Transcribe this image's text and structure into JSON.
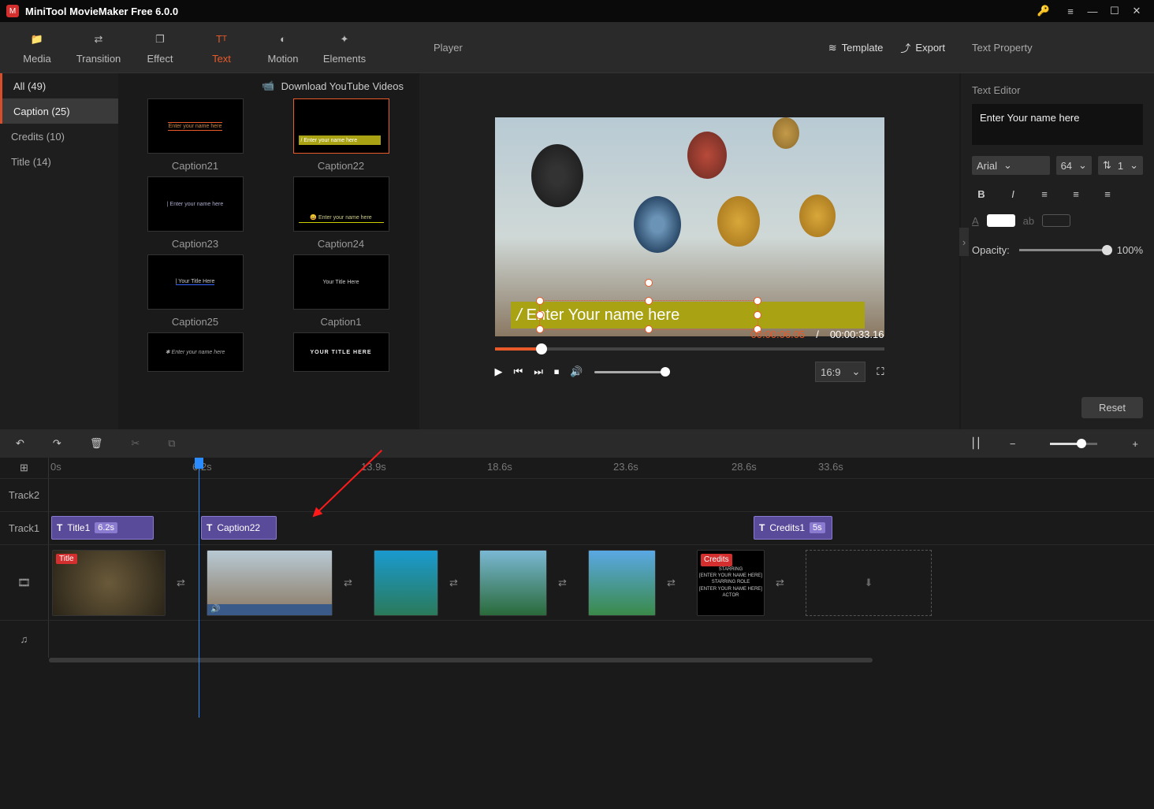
{
  "app": {
    "title": "MiniTool MovieMaker Free 6.0.0"
  },
  "toolbar": {
    "media": "Media",
    "transition": "Transition",
    "effect": "Effect",
    "text": "Text",
    "motion": "Motion",
    "elements": "Elements"
  },
  "browser": {
    "download": "Download YouTube Videos",
    "categories": {
      "all": "All (49)",
      "caption": "Caption (25)",
      "credits": "Credits (10)",
      "title": "Title (14)"
    },
    "items": [
      {
        "label": "Caption21"
      },
      {
        "label": "Caption22"
      },
      {
        "label": "Caption23"
      },
      {
        "label": "Caption24"
      },
      {
        "label": "Caption25"
      },
      {
        "label": "Caption1"
      },
      {
        "label": ""
      },
      {
        "label": ""
      }
    ]
  },
  "player": {
    "title": "Player",
    "template": "Template",
    "export": "Export",
    "caption_text": "Enter Your name here",
    "current_time": "00:00:06.05",
    "sep": "/",
    "total_time": "00:00:33.16",
    "aspect": "16:9"
  },
  "props": {
    "title": "Text Property",
    "editor": "Text Editor",
    "text_value": "Enter Your name here",
    "font": "Arial",
    "size": "64",
    "line": "1",
    "opacity_label": "Opacity:",
    "opacity_value": "100%",
    "reset": "Reset"
  },
  "timeline": {
    "ticks": [
      "0s",
      "6.2s",
      "13.9s",
      "18.6s",
      "23.6s",
      "28.6s",
      "33.6s"
    ],
    "tracks": {
      "t2": "Track2",
      "t1": "Track1"
    },
    "clips": {
      "title1": {
        "name": "Title1",
        "dur": "6.2s"
      },
      "caption": {
        "name": "Caption22"
      },
      "credits": {
        "name": "Credits1",
        "dur": "5s"
      }
    },
    "tags": {
      "title": "Title",
      "credits": "Credits"
    },
    "credits_lines": [
      "STARRING",
      "[ENTER YOUR NAME HERE]",
      "STARRING ROLE",
      "[ENTER YOUR NAME HERE]",
      "ACTOR"
    ]
  }
}
